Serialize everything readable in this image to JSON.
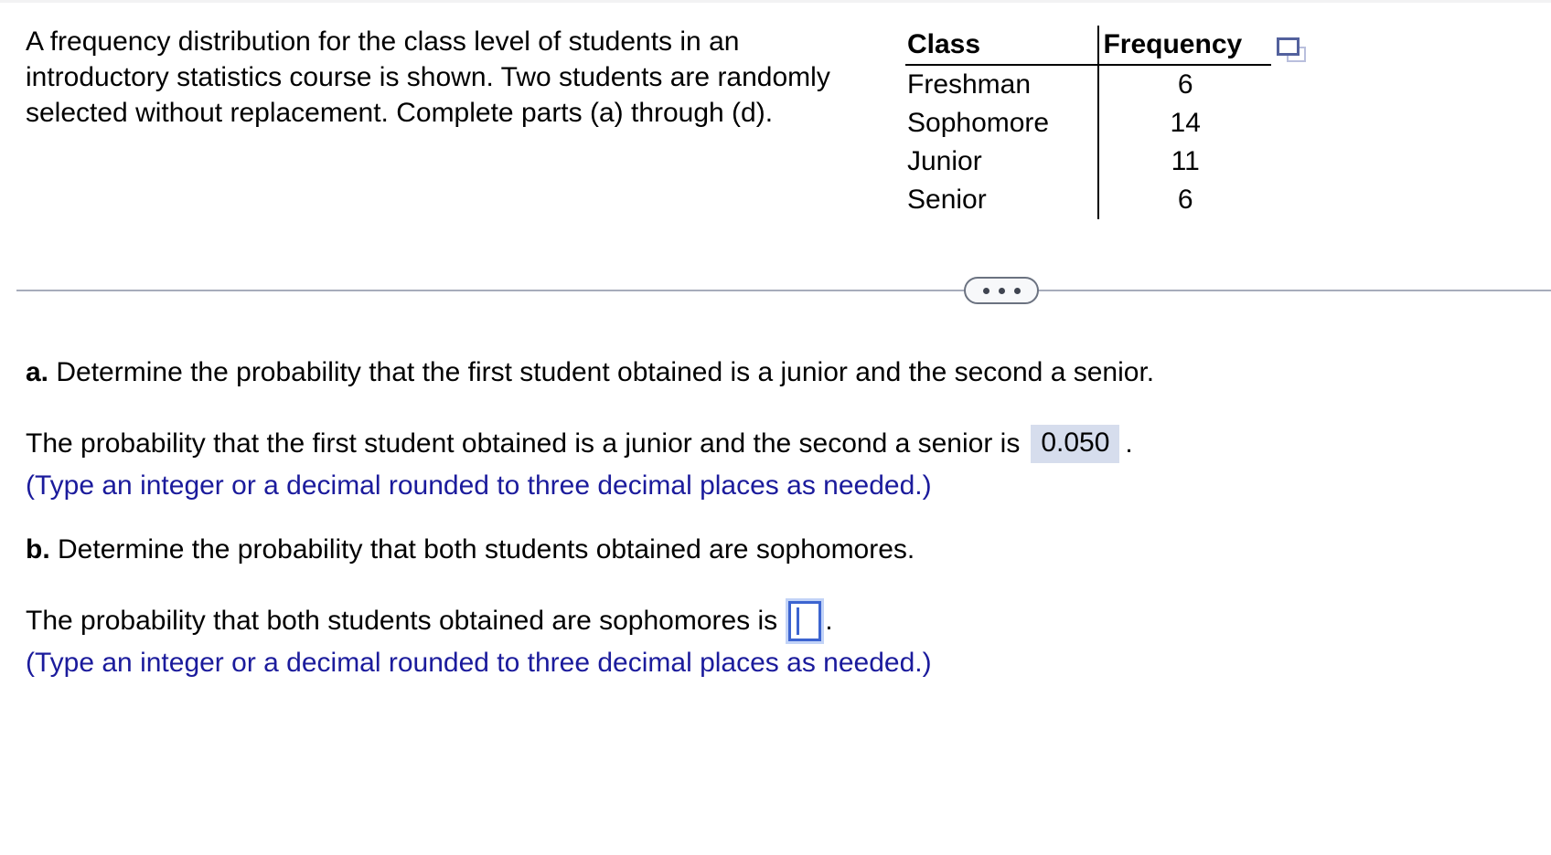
{
  "problem": {
    "stem": "A frequency distribution for the class level of students in an introductory statistics course is shown. Two students are randomly selected without replacement. Complete parts (a) through (d)."
  },
  "table": {
    "headers": [
      "Class",
      "Frequency"
    ],
    "rows": [
      {
        "class": "Freshman",
        "frequency": "6"
      },
      {
        "class": "Sophomore",
        "frequency": "14"
      },
      {
        "class": "Junior",
        "frequency": "11"
      },
      {
        "class": "Senior",
        "frequency": "6"
      }
    ],
    "copy_icon": "copy-to-spreadsheet-icon"
  },
  "divider": {
    "more_icon": "ellipsis-icon",
    "dots": [
      "•",
      "•",
      "•"
    ]
  },
  "parts": {
    "a": {
      "label": "a.",
      "prompt": "Determine the probability that the first student obtained is a junior and the second a senior.",
      "answer_prefix": "The probability that the first student obtained is a junior and the second a senior is",
      "answer_value": "0.050",
      "answer_suffix": ".",
      "note": "(Type an integer or a decimal rounded to three decimal places as needed.)"
    },
    "b": {
      "label": "b.",
      "prompt": "Determine the probability that both students obtained are sophomores.",
      "answer_prefix": "The probability that both students obtained are sophomores is",
      "answer_value": "",
      "answer_placeholder": "",
      "answer_suffix": ".",
      "note": "(Type an integer or a decimal rounded to three decimal places as needed.)"
    }
  },
  "colors": {
    "note_blue": "#1b1b9c",
    "answer_highlight": "#d6dded",
    "input_focus_border": "#3c64d0",
    "divider_gray": "#a7acbb",
    "icon_front": "#53619d",
    "icon_back": "#b9bfdd"
  }
}
